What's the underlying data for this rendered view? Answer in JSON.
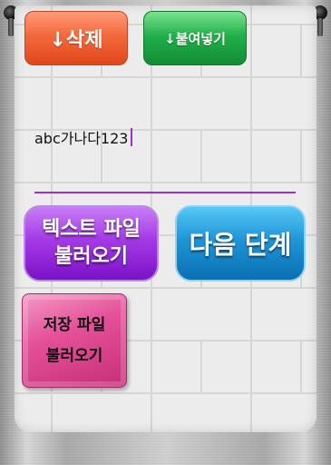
{
  "buttons": {
    "delete_label": "↓삭제",
    "paste_label": "↓붙여넣기",
    "load_text_line1": "텍스트 파일",
    "load_text_line2": "불러오기",
    "next_label": "다음 단계",
    "saved_line1": "저장 파일",
    "saved_line2": "불러오기"
  },
  "editor": {
    "value": "abc가나다123"
  },
  "colors": {
    "delete": "#f36a3c",
    "paste": "#22b04a",
    "load_text": "#a43ae6",
    "next": "#1f95d8",
    "saved": "#e5529a",
    "accent": "#9b30c8"
  }
}
